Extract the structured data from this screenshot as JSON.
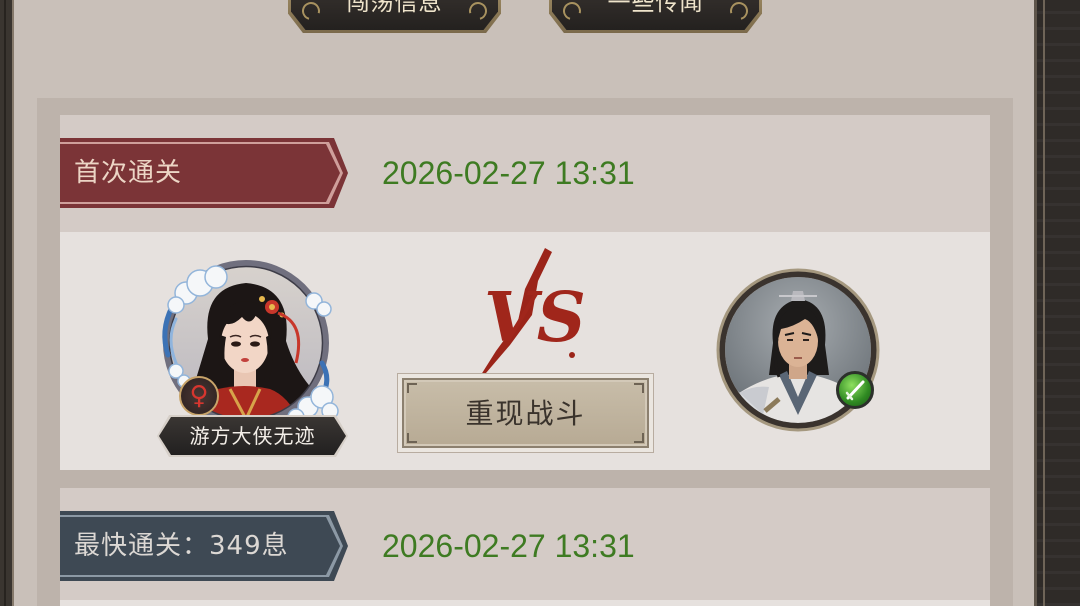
{
  "tabs": [
    {
      "label": "闯荡信息"
    },
    {
      "label": "一些传闻"
    }
  ],
  "records": [
    {
      "title": "首次通关",
      "time": "2026-02-27 13:31",
      "ribbon_color": "#7b3437",
      "ribbon_line_color": "#cf9f9b",
      "ribbon_text_color": "#ecd5c5"
    },
    {
      "title": "最快通关：349息",
      "time": "2026-02-27 13:31",
      "ribbon_color": "#3e4954",
      "ribbon_line_color": "#8c99a5",
      "ribbon_text_color": "#dcd8d4"
    }
  ],
  "battle": {
    "player": {
      "name": "游方大侠无迹",
      "gender_symbol": "♀",
      "avatar_icon": "female-wanderer-portrait"
    },
    "vs_text": "VS",
    "replay_button": "重现战斗",
    "opponent": {
      "avatar_icon": "male-swordsman-portrait",
      "badge_icon": "green-sword-badge-icon"
    }
  },
  "colors": {
    "time_text": "#3e7b22",
    "vs_red": "#9e2519",
    "gender_symbol": "#d7362f",
    "badge_green": "#2f8a22"
  }
}
